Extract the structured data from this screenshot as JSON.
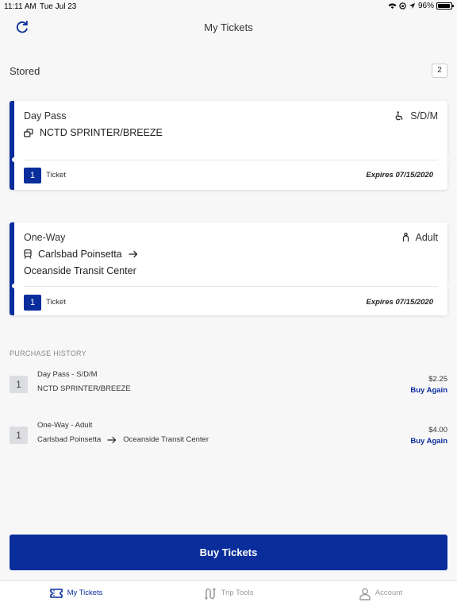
{
  "status_bar": {
    "time": "11:11 AM",
    "date": "Tue Jul 23",
    "battery": "96%",
    "battery_level": 0.96
  },
  "header": {
    "title": "My Tickets",
    "refresh_icon": "refresh-icon"
  },
  "stored": {
    "label": "Stored",
    "count": "2"
  },
  "tickets": [
    {
      "type": "Day Pass",
      "rider": "S/D/M",
      "rider_icon": "wheelchair-icon",
      "route_icon": "transfer-icon",
      "route": "NCTD SPRINTER/BREEZE",
      "quantity": "1",
      "unit": "Ticket",
      "expires": "Expires 07/15/2020"
    },
    {
      "type": "One-Way",
      "rider": "Adult",
      "rider_icon": "person-icon",
      "route_icon": "train-icon",
      "origin": "Carlsbad Poinsetta",
      "destination": "Oceanside Transit Center",
      "quantity": "1",
      "unit": "Ticket",
      "expires": "Expires 07/15/2020"
    }
  ],
  "purchase_history": {
    "header": "PURCHASE HISTORY",
    "items": [
      {
        "quantity": "1",
        "line1": "Day Pass  -  S/D/M",
        "route": "NCTD SPRINTER/BREEZE",
        "price": "$2.25",
        "action": "Buy Again"
      },
      {
        "quantity": "1",
        "line1": "One-Way  -  Adult",
        "origin": "Carlsbad Poinsetta",
        "destination": "Oceanside Transit Center",
        "price": "$4.00",
        "action": "Buy Again"
      }
    ]
  },
  "buy_button": "Buy Tickets",
  "tabs": [
    {
      "label": "My Tickets",
      "icon": "ticket-icon",
      "active": true
    },
    {
      "label": "Trip Tools",
      "icon": "route-icon",
      "active": false
    },
    {
      "label": "Account",
      "icon": "account-icon",
      "active": false
    }
  ],
  "colors": {
    "primary": "#0a2d9c",
    "background": "#f7f7f8",
    "muted": "#999999"
  }
}
